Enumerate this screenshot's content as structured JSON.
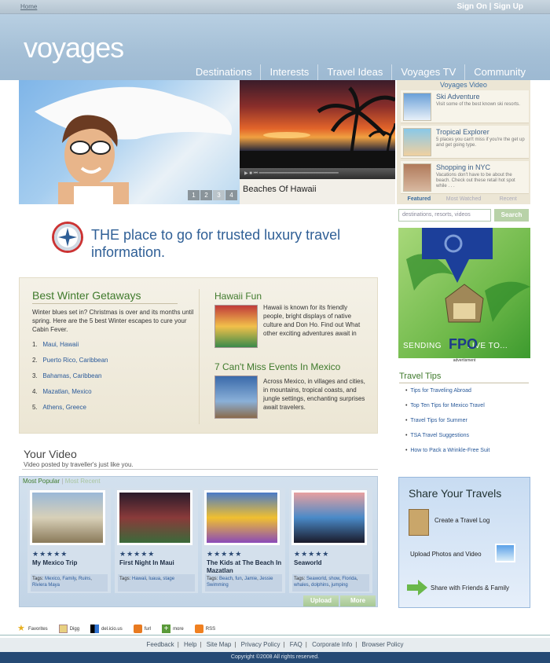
{
  "topbar": {
    "home": "Home",
    "sign_in": "Sign On",
    "sep": "|",
    "sign_up": "Sign Up"
  },
  "header": {
    "logo": "voyages"
  },
  "nav": [
    "Destinations",
    "Interests",
    "Travel Ideas",
    "Voyages TV",
    "Community"
  ],
  "hero": {
    "caption": "Beaches Of Hawaii",
    "slides": [
      "1",
      "2",
      "3",
      "4"
    ],
    "active_slide": "3"
  },
  "voyages_video": {
    "title": "Voyages Video",
    "items": [
      {
        "name": "Ski Adventure",
        "desc": "Visit some of the best known ski resorts."
      },
      {
        "name": "Tropical Explorer",
        "desc": "5 places you can't miss if you're the get up and get going type."
      },
      {
        "name": "Shopping in NYC",
        "desc": "Vacations don't have to be about the beach. Check out these retail hot spot while . . ."
      }
    ],
    "tabs": [
      "Featured",
      "Most Watched",
      "Recent"
    ]
  },
  "tagline": "THE place to go for trusted luxury travel information.",
  "getaways": {
    "title": "Best Winter Getaways",
    "intro": "Winter blues set in? Christmas is over and its months until spring. Here are the 5 best Winter escapes to cure your Cabin Fever.",
    "items": [
      "Maui, Hawaii",
      "Puerto Rico, Caribbean",
      "Bahamas, Caribbean",
      "Mazatlan, Mexico",
      "Athens, Greece"
    ]
  },
  "hawaii": {
    "title": "Hawaii Fun",
    "text": "Hawaii is known for its friendly people, bright displays of native culture and Don Ho. Find out What other exciting adventures await in"
  },
  "mexico": {
    "title": "7 Can't Miss Events In Mexico",
    "text": "Across Mexico, in villages and cities, in mountains, tropical coasts, and jungle settings, enchanting surprises await travelers."
  },
  "search": {
    "placeholder": "destinations, resorts, videos",
    "button": "Search"
  },
  "ad": {
    "text": "SENDING",
    "fpo": "FPO",
    "text2": "LIVE TO...",
    "label": "advertisment"
  },
  "travel_tips": {
    "title": "Travel Tips",
    "items": [
      "Tips for Traveling Abroad",
      "Top Ten Tips for Mexico  Travel",
      "Travel Tips for Summer",
      "TSA Travel Suggestions",
      "How to Pack a Wrinkle-Free Suit"
    ]
  },
  "your_video": {
    "title": "Your Video",
    "subtitle": "Video posted by traveller's just like you.",
    "tabs": [
      "Most Popular",
      "Most Recent"
    ],
    "cards": [
      {
        "title": "My Mexico Trip",
        "tags_label": "Tags:",
        "tags": [
          "Mexico",
          "Family",
          "Ruins",
          "Riviera Maya"
        ]
      },
      {
        "title": "First Night In Maui",
        "tags_label": "Tags:",
        "tags": [
          "Hawaii",
          "luaua",
          "stage"
        ]
      },
      {
        "title": "The Kids at The Beach In Mazatlan",
        "tags_label": "Tags:",
        "tags": [
          "Beach",
          "fun",
          "Jamie",
          "Jessie",
          "Swimming"
        ]
      },
      {
        "title": "Seaworld",
        "tags_label": "Tags:",
        "tags": [
          "Seaworld",
          "show",
          "Florida",
          "whales",
          "dolphins",
          "jumping"
        ]
      }
    ],
    "stars": "★★★★★",
    "upload": "Upload",
    "more": "More"
  },
  "share": {
    "title": "Share Your Travels",
    "rows": [
      "Create a Travel Log",
      "Upload Photos and Video",
      "Share with Friends & Family"
    ]
  },
  "social": [
    "Favorites",
    "Digg",
    "del.icio.us",
    "furl",
    "more",
    "RSS"
  ],
  "footer": {
    "links": [
      "Feedback",
      "Help",
      "Site Map",
      "Privacy Policy",
      "FAQ",
      "Corporate Info",
      "Browser Policy"
    ],
    "sep": "|",
    "copyright": "Copyright ©2008 All rights reserved."
  },
  "colors": {
    "green": "#3f7a2c",
    "blue": "#2f5f96",
    "navy": "#264a74",
    "header": "#a4bfd6"
  }
}
